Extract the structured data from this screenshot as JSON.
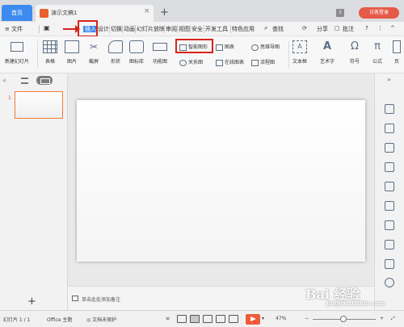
{
  "tabs": {
    "home": "首页",
    "document": "演示文稿1",
    "close": "×",
    "add": "+"
  },
  "window": {
    "badge": "1",
    "login": "访客登录"
  },
  "menubar": {
    "file": "≡ 文件",
    "items": [
      "开始",
      "插入",
      "设计",
      "切换",
      "动画",
      "幻灯片放映",
      "审阅",
      "视图",
      "安全",
      "开发工具",
      "特色应用"
    ],
    "search": "查找",
    "share": "分享",
    "comment": "批注",
    "help": "?",
    "more": "⋮"
  },
  "ribbon": {
    "new_slide": "新建幻灯片",
    "table": "表格",
    "image": "图片",
    "screenshot": "截屏",
    "shape": "形状",
    "icon_lib": "图标库",
    "func_chart": "功能图",
    "smart_art": "智能图形",
    "chart": "图表",
    "relation": "关系图",
    "online_chart": "在线图表",
    "mind_map": "思维导图",
    "flowchart": "流程图",
    "textbox": "文本框",
    "wordart": "艺术字",
    "symbol": "符号",
    "formula": "公式",
    "page_cut": "页"
  },
  "slides_panel": {
    "slide_number": "1",
    "add": "+"
  },
  "notes": {
    "placeholder": "单击此处添加备注"
  },
  "statusbar": {
    "slide_info": "幻灯片 1 / 1",
    "theme": "Office 主题",
    "protect": "文档未保护",
    "zoom": "47%",
    "minus": "−",
    "plus": "+"
  },
  "watermark": {
    "brand": "Bai 经验",
    "sub": "jingyan.baidu.com"
  },
  "colors": {
    "accent_blue": "#3d8bf0",
    "highlight_red": "#d9241b",
    "login_red": "#e55a48",
    "play_orange": "#ef5b3a"
  }
}
